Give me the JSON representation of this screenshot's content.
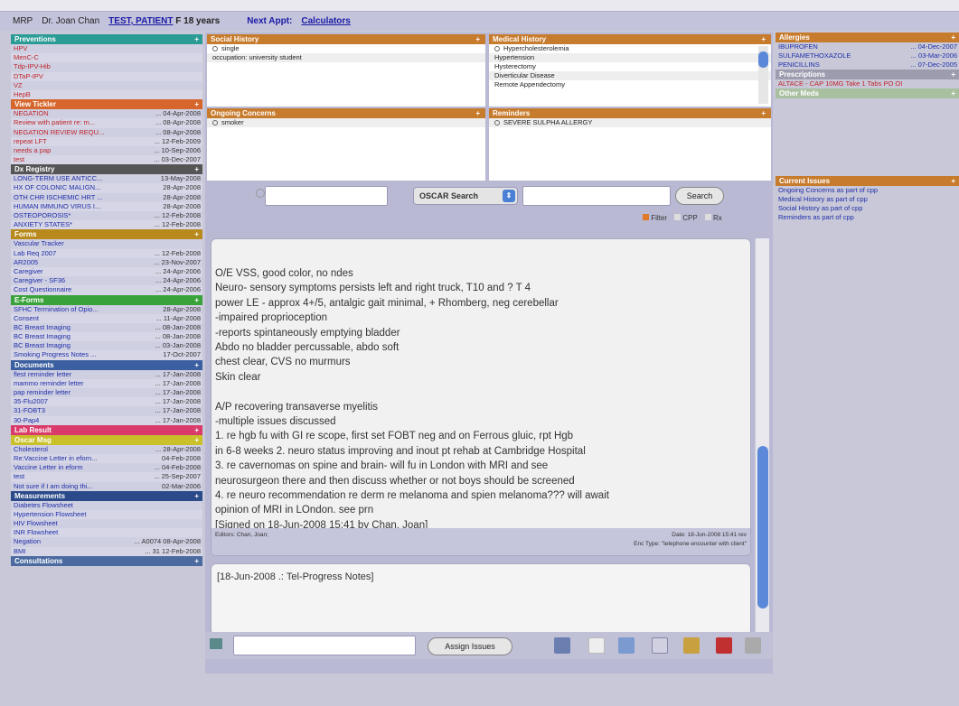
{
  "topbar": {
    "mrp": "MRP",
    "doctor": "Dr. Joan Chan",
    "patient": "TEST, PATIENT",
    "age": "F 18 years",
    "next_appt": "Next Appt:",
    "calculators": "Calculators"
  },
  "left": {
    "preventions": {
      "title": "Preventions",
      "items": [
        "HPV",
        "MenC-C",
        "Tdp-IPV-Hib",
        "DTaP-IPV",
        "VZ",
        "HepB"
      ]
    },
    "tickler": {
      "title": "View Tickler",
      "items": [
        [
          "NEGATION",
          "... 04-Apr-2008"
        ],
        [
          "Review with patient re: m...",
          "... 08-Apr-2008"
        ],
        [
          "NEGATION REVIEW REQU...",
          "... 08-Apr-2008"
        ],
        [
          "repeat LFT",
          "... 12-Feb-2009"
        ],
        [
          "needs a pap",
          "... 10-Sep-2006"
        ],
        [
          "test",
          "... 03-Dec-2007"
        ]
      ]
    },
    "dx": {
      "title": "Dx Registry",
      "items": [
        [
          "LONG-TERM USE ANTICC...",
          "13-May-2008"
        ],
        [
          "HX OF COLONIC MALIGN...",
          "28-Apr-2008"
        ],
        [
          "OTH CHR ISCHEMIC HRT ...",
          "28-Apr-2008"
        ],
        [
          "HUMAN IMMUNO VIRUS I...",
          "28-Apr-2008"
        ],
        [
          "OSTEOPOROSIS*",
          "... 12-Feb-2008"
        ],
        [
          "ANXIETY STATES*",
          "... 12-Feb-2008"
        ]
      ]
    },
    "forms": {
      "title": "Forms",
      "items": [
        [
          "Vascular Tracker",
          ""
        ],
        [
          "Lab Req 2007",
          "... 12-Feb-2008"
        ],
        [
          "AR2005",
          "... 23-Nov-2007"
        ],
        [
          "Caregiver",
          "... 24-Apr-2006"
        ],
        [
          "Caregiver - SF36",
          "... 24-Apr-2006"
        ],
        [
          "Cost Questionnaire",
          "... 24-Apr-2006"
        ]
      ]
    },
    "eforms": {
      "title": "E-Forms",
      "items": [
        [
          "SFHC Termination of Opio...",
          "28-Apr-2008"
        ],
        [
          "Consent",
          "... 11-Apr-2008"
        ],
        [
          "BC Breast Imaging",
          "... 08-Jan-2008"
        ],
        [
          "BC Breast Imaging",
          "... 08-Jan-2008"
        ],
        [
          "BC Breast Imaging",
          "... 03-Jan-2008"
        ],
        [
          "Smoking Progress Notes ...",
          "17-Oct-2007"
        ]
      ]
    },
    "documents": {
      "title": "Documents",
      "items": [
        [
          "flest reminder letter",
          "... 17-Jan-2008"
        ],
        [
          "mammo reminder letter",
          "... 17-Jan-2008"
        ],
        [
          "pap reminder letter",
          "... 17-Jan-2008"
        ],
        [
          "35-Flu2007",
          "... 17-Jan-2008"
        ],
        [
          "31-FOBT3",
          "... 17-Jan-2008"
        ],
        [
          "30-Pap4",
          "... 17-Jan-2008"
        ]
      ]
    },
    "lab": {
      "title": "Lab Result"
    },
    "oscarmsg": {
      "title": "Oscar Msg",
      "items": [
        [
          "Cholesterol",
          "... 28-Apr-2008"
        ],
        [
          "Re:Vaccine Letter in eforn...",
          "04-Feb-2008"
        ],
        [
          "Vaccine Letter in eform",
          "... 04-Feb-2008"
        ],
        [
          "test",
          "... 25-Sep-2007"
        ],
        [
          "Not sure if I am doing thi...",
          "02-Mar-2006"
        ]
      ]
    },
    "measurements": {
      "title": "Measurements",
      "items": [
        [
          "Diabetes Flowsheet",
          ""
        ],
        [
          "Hypertension Flowsheet",
          ""
        ],
        [
          "HIV Flowsheet",
          ""
        ],
        [
          "INR Flowsheet",
          ""
        ],
        [
          "Negation",
          "... A0074 08-Apr-2008"
        ],
        [
          "BMI",
          "... 31 12-Feb-2008"
        ]
      ]
    },
    "consultations": {
      "title": "Consultations"
    }
  },
  "center": {
    "social": {
      "title": "Social History",
      "items": [
        "single",
        "occupation: university student"
      ]
    },
    "medical": {
      "title": "Medical History",
      "items": [
        "Hypercholesterolemia",
        "Hypertension",
        "Hysterectomy",
        "Diverticular Disease",
        "Remote Appendectomy"
      ]
    },
    "ongoing": {
      "title": "Ongoing Concerns",
      "items": [
        "smoker"
      ]
    },
    "reminders": {
      "title": "Reminders",
      "items": [
        "SEVERE SULPHA ALLERGY"
      ]
    },
    "search": {
      "select": "OSCAR Search",
      "button": "Search",
      "filter": "Filter",
      "cpp": "CPP",
      "rx": "Rx"
    },
    "note_lines": [
      "O/E VSS, good color, no ndes",
      "Neuro- sensory symptoms persists left and right truck, T10 and ? T 4",
      "power LE - approx 4+/5, antalgic gait minimal, + Rhomberg, neg cerebellar",
      "-impaired proprioception",
      "-reports spintaneously emptying bladder",
      "Abdo no bladder percussable, abdo soft",
      "chest clear, CVS no murmurs",
      "Skin clear",
      "",
      "A/P recovering transaverse myelitis",
      "-multiple issues discussed",
      "1. re hgb fu with GI re scope, first set FOBT neg and on Ferrous gluic, rpt Hgb",
      "in 6-8 weeks 2. neuro status improving and inout pt rehab at Cambridge Hospital",
      "3. re cavernomas on spine and brain- will fu in London with MRI and see",
      "neurosurgeon there and then discuss whether or not boys should be screened",
      "4. re neuro recommendation re derm re melanoma and spien melanoma??? will await",
      "opinion of MRI in LOndon. see prn",
      "[Signed on 18-Jun-2008 15:41 by Chan, Joan]"
    ],
    "editors": "Editors:   Chan, Joan;",
    "note_date": "Date: 18-Jun-2008 15:41 rev",
    "enc_type": "Enc Type: \"telephone encounter with client\"",
    "note2": "[18-Jun-2008 .: Tel-Progress Notes]",
    "assign": "Assign Issues"
  },
  "right": {
    "allergies": {
      "title": "Allergies",
      "items": [
        [
          "IBUPROFEN",
          "... 04-Dec-2007"
        ],
        [
          "SULFAMETHOXAZOLE",
          "... 03-Mar-2006"
        ],
        [
          "PENICILLINS",
          "... 07-Dec-2005"
        ]
      ]
    },
    "prescriptions": {
      "title": "Prescriptions",
      "items": [
        "ALTACE - CAP 10MG Take 1 Tabs PO OI"
      ]
    },
    "othermeds": {
      "title": "Other Meds"
    },
    "issues": {
      "title": "Current Issues",
      "items": [
        "Ongoing Concerns as part of cpp",
        "Medical History as part of cpp",
        "Social History as part of cpp",
        "Reminders as part of cpp"
      ]
    }
  }
}
